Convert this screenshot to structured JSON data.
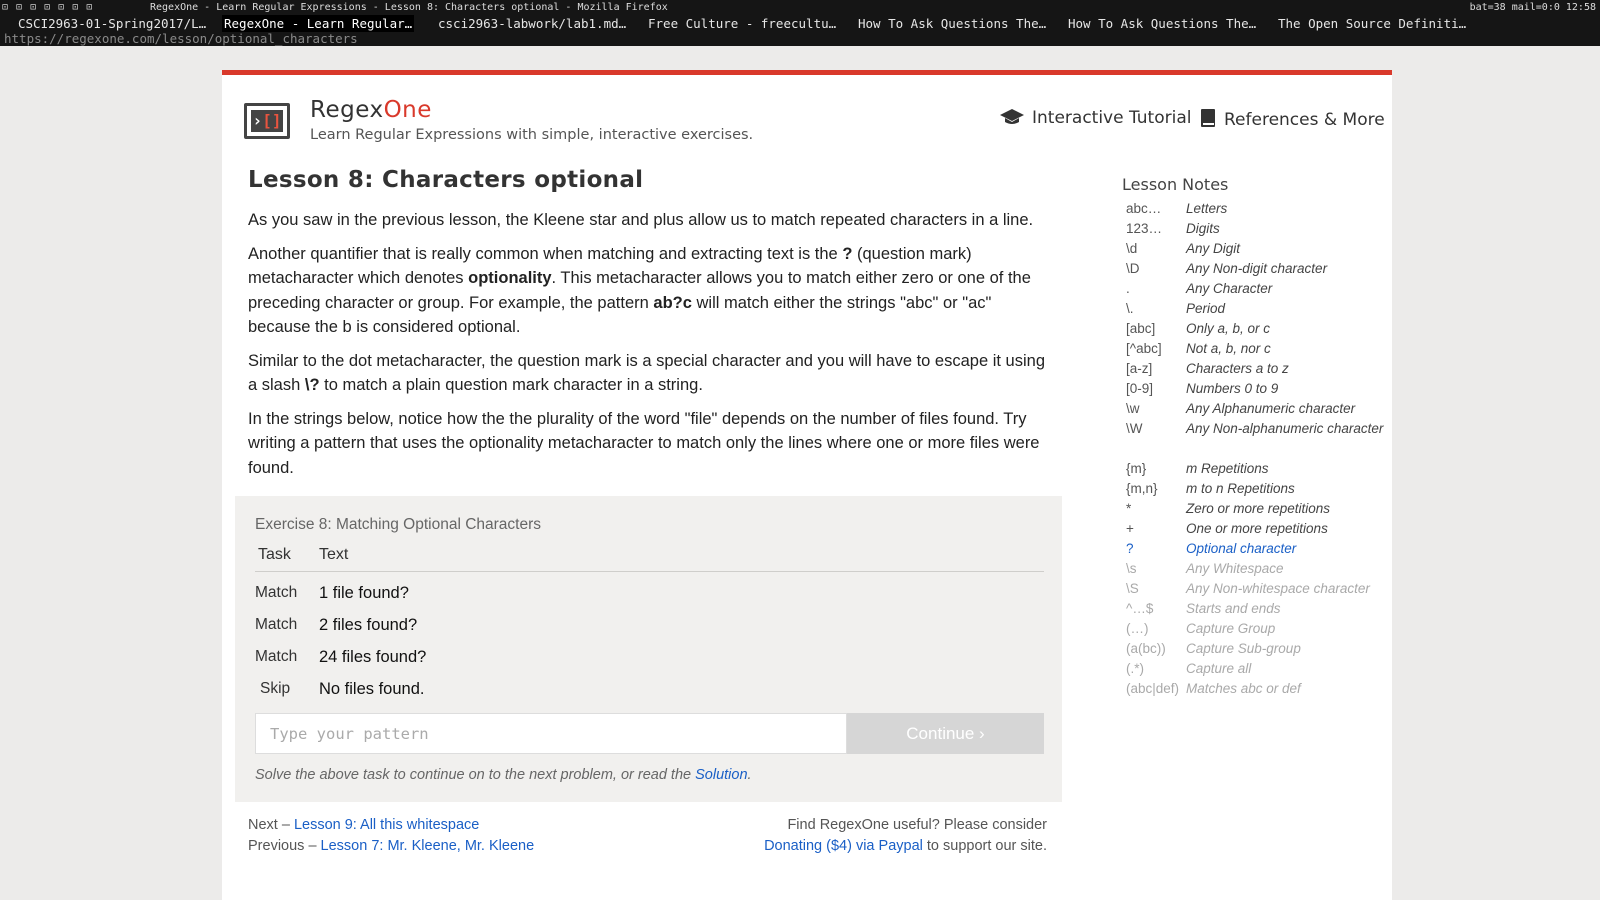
{
  "wm": {
    "glyphs": "⊡ ⊡ ⊡ ⊡ ⊡ ⊡ ⊡",
    "window_title": "RegexOne - Learn Regular Expressions - Lesson 8: Characters optional - Mozilla Firefox",
    "status": "bat=38 mail=0:0 12:58"
  },
  "tabs": [
    "CSCI2963-01-Spring2017/L…",
    "RegexOne - Learn Regular…",
    "csci2963-labwork/lab1.md…",
    "Free Culture - freecultu…",
    "How To Ask Questions The…",
    "How To Ask Questions The…",
    "The Open Source Definiti…"
  ],
  "url": "https://regexone.com/lesson/optional_characters",
  "header": {
    "brand_part1": "Regex",
    "brand_part2": "One",
    "tagline": "Learn Regular Expressions with simple, interactive exercises.",
    "nav_tutorial": "Interactive Tutorial",
    "nav_refs": "References & More"
  },
  "lesson": {
    "title": "Lesson 8: Characters optional",
    "p1": "As you saw in the previous lesson, the Kleene star and plus allow us to match repeated characters in a line.",
    "p2_a": "Another quantifier that is really common when matching and extracting text is the ",
    "p2_b": "?",
    "p2_c": " (question mark) metacharacter which denotes ",
    "p2_d": "optionality",
    "p2_e": ". This metacharacter allows you to match either zero or one of the preceding character or group. For example, the pattern ",
    "p2_f": "ab?c",
    "p2_g": " will match either the strings \"abc\" or \"ac\" because the b is considered optional.",
    "p3_a": "Similar to the dot metacharacter, the question mark is a special character and you will have to escape it using a slash ",
    "p3_b": "\\?",
    "p3_c": " to match a plain question mark character in a string.",
    "p4": "In the strings below, notice how the the plurality of the word \"file\" depends on the number of files found. Try writing a pattern that uses the optionality metacharacter to match only the lines where one or more files were found."
  },
  "exercise": {
    "title": "Exercise 8: Matching Optional Characters",
    "head_task": "Task",
    "head_text": "Text",
    "rows": [
      {
        "task": "Match",
        "text": "1 file found?"
      },
      {
        "task": "Match",
        "text": "2 files found?"
      },
      {
        "task": "Match",
        "text": "24 files found?"
      },
      {
        "task": "Skip",
        "text": "No files found."
      }
    ],
    "input_placeholder": "Type your pattern",
    "continue_label": "Continue ›",
    "note_before": "Solve the above task to continue on to the next problem, or read the ",
    "note_link": "Solution",
    "note_after": "."
  },
  "footer": {
    "next_prefix": "Next – ",
    "next_link": "Lesson 9: All this whitespace",
    "prev_prefix": "Previous – ",
    "prev_link": "Lesson 7: Mr. Kleene, Mr. Kleene",
    "find_text": "Find RegexOne useful? Please consider",
    "donate_link": "Donating ($4) via Paypal",
    "donate_suffix": " to support our site."
  },
  "notes": {
    "title": "Lesson Notes",
    "items": [
      {
        "k": "abc…",
        "v": "Letters",
        "state": "done"
      },
      {
        "k": "123…",
        "v": "Digits",
        "state": "done"
      },
      {
        "k": "\\d",
        "v": "Any Digit",
        "state": "done"
      },
      {
        "k": "\\D",
        "v": "Any Non-digit character",
        "state": "done"
      },
      {
        "k": ".",
        "v": "Any Character",
        "state": "done"
      },
      {
        "k": "\\.",
        "v": "Period",
        "state": "done"
      },
      {
        "k": "[abc]",
        "v": "Only a, b, or c",
        "state": "done"
      },
      {
        "k": "[^abc]",
        "v": "Not a, b, nor c",
        "state": "done"
      },
      {
        "k": "[a-z]",
        "v": "Characters a to z",
        "state": "done"
      },
      {
        "k": "[0-9]",
        "v": "Numbers 0 to 9",
        "state": "done"
      },
      {
        "k": "\\w",
        "v": "Any Alphanumeric character",
        "state": "done"
      },
      {
        "k": "\\W",
        "v": "Any Non-alphanumeric character",
        "state": "done"
      },
      {
        "k": "{m}",
        "v": "m Repetitions",
        "state": "done"
      },
      {
        "k": "{m,n}",
        "v": "m to n Repetitions",
        "state": "done"
      },
      {
        "k": "*",
        "v": "Zero or more repetitions",
        "state": "done"
      },
      {
        "k": "+",
        "v": "One or more repetitions",
        "state": "done"
      },
      {
        "k": "?",
        "v": "Optional character",
        "state": "active"
      },
      {
        "k": "\\s",
        "v": "Any Whitespace",
        "state": "future"
      },
      {
        "k": "\\S",
        "v": "Any Non-whitespace character",
        "state": "future"
      },
      {
        "k": "^…$",
        "v": "Starts and ends",
        "state": "future"
      },
      {
        "k": "(…)",
        "v": "Capture Group",
        "state": "future"
      },
      {
        "k": "(a(bc))",
        "v": "Capture Sub-group",
        "state": "future"
      },
      {
        "k": "(.*)",
        "v": "Capture all",
        "state": "future"
      },
      {
        "k": "(abc|def)",
        "v": "Matches abc or def",
        "state": "future"
      }
    ]
  },
  "colors": {
    "accent": "#d9392b",
    "link": "#1a5fc6",
    "exercise_bg": "#f1f0ee"
  }
}
